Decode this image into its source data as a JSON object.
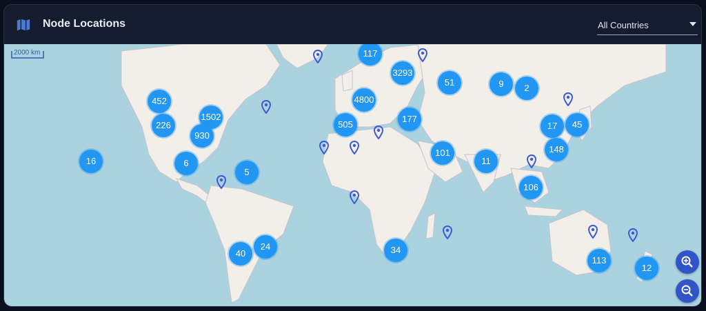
{
  "header": {
    "title": "Node Locations",
    "icon": "map-icon"
  },
  "filter": {
    "selected": "All Countries"
  },
  "map": {
    "scale_label": "2000 km",
    "clusters": [
      {
        "label": "117",
        "region": "north-sea"
      },
      {
        "label": "3293",
        "region": "scandinavia-baltic"
      },
      {
        "label": "51",
        "region": "central-russia"
      },
      {
        "label": "9",
        "region": "siberia"
      },
      {
        "label": "2",
        "region": "east-siberia"
      },
      {
        "label": "452",
        "region": "western-canada"
      },
      {
        "label": "1502",
        "region": "central-usa"
      },
      {
        "label": "226",
        "region": "california"
      },
      {
        "label": "930",
        "region": "texas"
      },
      {
        "label": "4800",
        "region": "western-europe"
      },
      {
        "label": "505",
        "region": "iberia"
      },
      {
        "label": "177",
        "region": "turkey"
      },
      {
        "label": "17",
        "region": "china"
      },
      {
        "label": "45",
        "region": "japan"
      },
      {
        "label": "148",
        "region": "taiwan"
      },
      {
        "label": "16",
        "region": "hawaii"
      },
      {
        "label": "6",
        "region": "mexico"
      },
      {
        "label": "5",
        "region": "caribbean"
      },
      {
        "label": "101",
        "region": "arabia"
      },
      {
        "label": "11",
        "region": "india"
      },
      {
        "label": "106",
        "region": "southeast-asia"
      },
      {
        "label": "40",
        "region": "chile"
      },
      {
        "label": "24",
        "region": "argentina"
      },
      {
        "label": "34",
        "region": "south-africa"
      },
      {
        "label": "113",
        "region": "southeast-australia"
      },
      {
        "label": "12",
        "region": "new-zealand"
      }
    ],
    "pins": [
      "iceland",
      "moscow",
      "newfoundland",
      "korea",
      "azores",
      "morocco",
      "canary-islands",
      "panama",
      "ghana",
      "indochina",
      "mauritius",
      "western-australia",
      "new-caledonia"
    ]
  },
  "zoom": {
    "in_icon": "zoom-in-icon",
    "out_icon": "zoom-out-icon"
  },
  "colors": {
    "water": "#aad3df",
    "land": "#f2efe9",
    "cluster": "#2196f3",
    "pin": "#3b5bd6",
    "zoom": "#2f55c8"
  }
}
